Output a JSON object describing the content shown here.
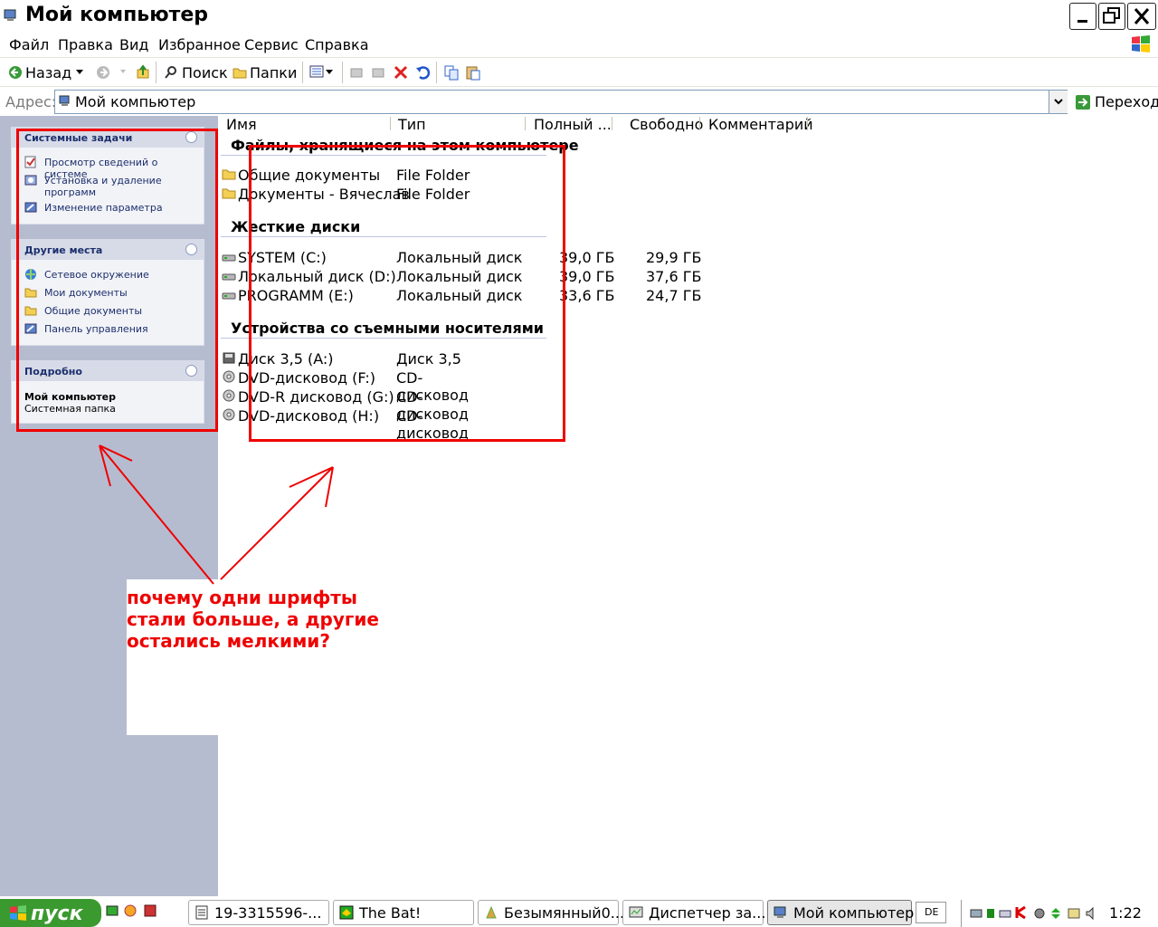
{
  "window": {
    "title": "Мой компьютер"
  },
  "menu": [
    "Файл",
    "Правка",
    "Вид",
    "Избранное",
    "Сервис",
    "Справка"
  ],
  "toolbar": {
    "back": "Назад",
    "search": "Поиск",
    "folders": "Папки"
  },
  "address": {
    "label": "Адрес:",
    "value": "Мой компьютер",
    "go": "Переход"
  },
  "tasks": {
    "system": {
      "title": "Системные задачи",
      "items": [
        "Просмотр сведений о системе",
        "Установка и удаление программ",
        "Изменение параметра"
      ]
    },
    "places": {
      "title": "Другие места",
      "items": [
        "Сетевое окружение",
        "Мои документы",
        "Общие документы",
        "Панель управления"
      ]
    },
    "details": {
      "title": "Подробно",
      "name": "Мой компьютер",
      "sub": "Системная папка"
    }
  },
  "columns": [
    "Имя",
    "Тип",
    "Полный ...",
    "Свободно",
    "Комментарий"
  ],
  "groups": {
    "files": {
      "title": "Файлы, хранящиеся на этом компьютере",
      "rows": [
        {
          "name": "Общие документы",
          "type": "File Folder"
        },
        {
          "name": "Документы - Вячеслав",
          "type": "File Folder"
        }
      ]
    },
    "hdd": {
      "title": "Жесткие диски",
      "rows": [
        {
          "name": "SYSTEM (C:)",
          "type": "Локальный диск",
          "total": "39,0 ГБ",
          "free": "29,9 ГБ"
        },
        {
          "name": "Локальный диск (D:)",
          "type": "Локальный диск",
          "total": "39,0 ГБ",
          "free": "37,6 ГБ"
        },
        {
          "name": "PROGRAMM (E:)",
          "type": "Локальный диск",
          "total": "33,6 ГБ",
          "free": "24,7 ГБ"
        }
      ]
    },
    "removable": {
      "title": "Устройства со съемными носителями",
      "rows": [
        {
          "name": "Диск 3,5 (A:)",
          "type": "Диск 3,5"
        },
        {
          "name": "DVD-дисковод (F:)",
          "type": "CD-дисковод"
        },
        {
          "name": "DVD-R дисковод (G:)",
          "type": "CD-дисковод"
        },
        {
          "name": "DVD-дисковод (H:)",
          "type": "CD-дисковод"
        }
      ]
    }
  },
  "annotation": {
    "text": "почему одни шрифты стали больше, а другие остались мелкими?"
  },
  "taskbar": {
    "start": "пуск",
    "buttons": [
      "19-3315596-...",
      "The Bat!",
      "Безымянный0...",
      "Диспетчер за...",
      "Мой компьютер"
    ],
    "lang": "DE",
    "clock": "1:22"
  },
  "colors": {
    "annotation": "#e00000",
    "panel": "#b6bcd0",
    "link": "#1c2f6c"
  }
}
